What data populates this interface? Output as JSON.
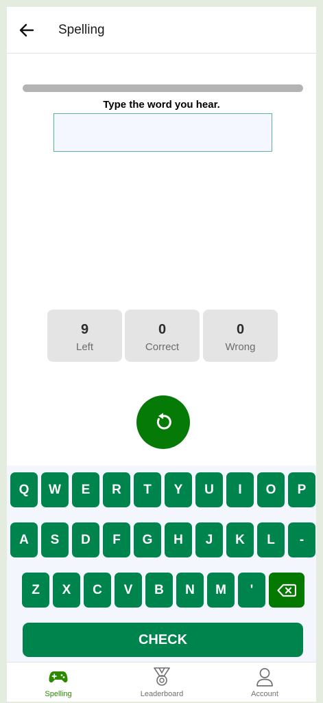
{
  "header": {
    "title": "Spelling",
    "back_icon": "arrow-left-icon"
  },
  "progress": {
    "fraction": 0
  },
  "prompt": "Type the word you hear.",
  "answer": {
    "value": "",
    "placeholder": ""
  },
  "stats": [
    {
      "value": "9",
      "label": "Left"
    },
    {
      "value": "0",
      "label": "Correct"
    },
    {
      "value": "0",
      "label": "Wrong"
    }
  ],
  "replay_icon": "replay-icon",
  "keyboard": {
    "rows": [
      [
        "Q",
        "W",
        "E",
        "R",
        "T",
        "Y",
        "U",
        "I",
        "O",
        "P"
      ],
      [
        "A",
        "S",
        "D",
        "F",
        "G",
        "H",
        "J",
        "K",
        "L",
        "-"
      ],
      [
        "Z",
        "X",
        "C",
        "V",
        "B",
        "N",
        "M",
        "'"
      ]
    ],
    "backspace_icon": "backspace-icon",
    "check_label": "CHECK"
  },
  "nav": {
    "items": [
      {
        "label": "Spelling",
        "icon": "gamepad-icon",
        "active": true
      },
      {
        "label": "Leaderboard",
        "icon": "medal-icon",
        "active": false
      },
      {
        "label": "Account",
        "icon": "user-icon",
        "active": false
      }
    ]
  },
  "colors": {
    "primary": "#00844e",
    "replay": "#067a06",
    "active_nav": "#2d8a00",
    "progress_track": "#b3b3b3"
  }
}
